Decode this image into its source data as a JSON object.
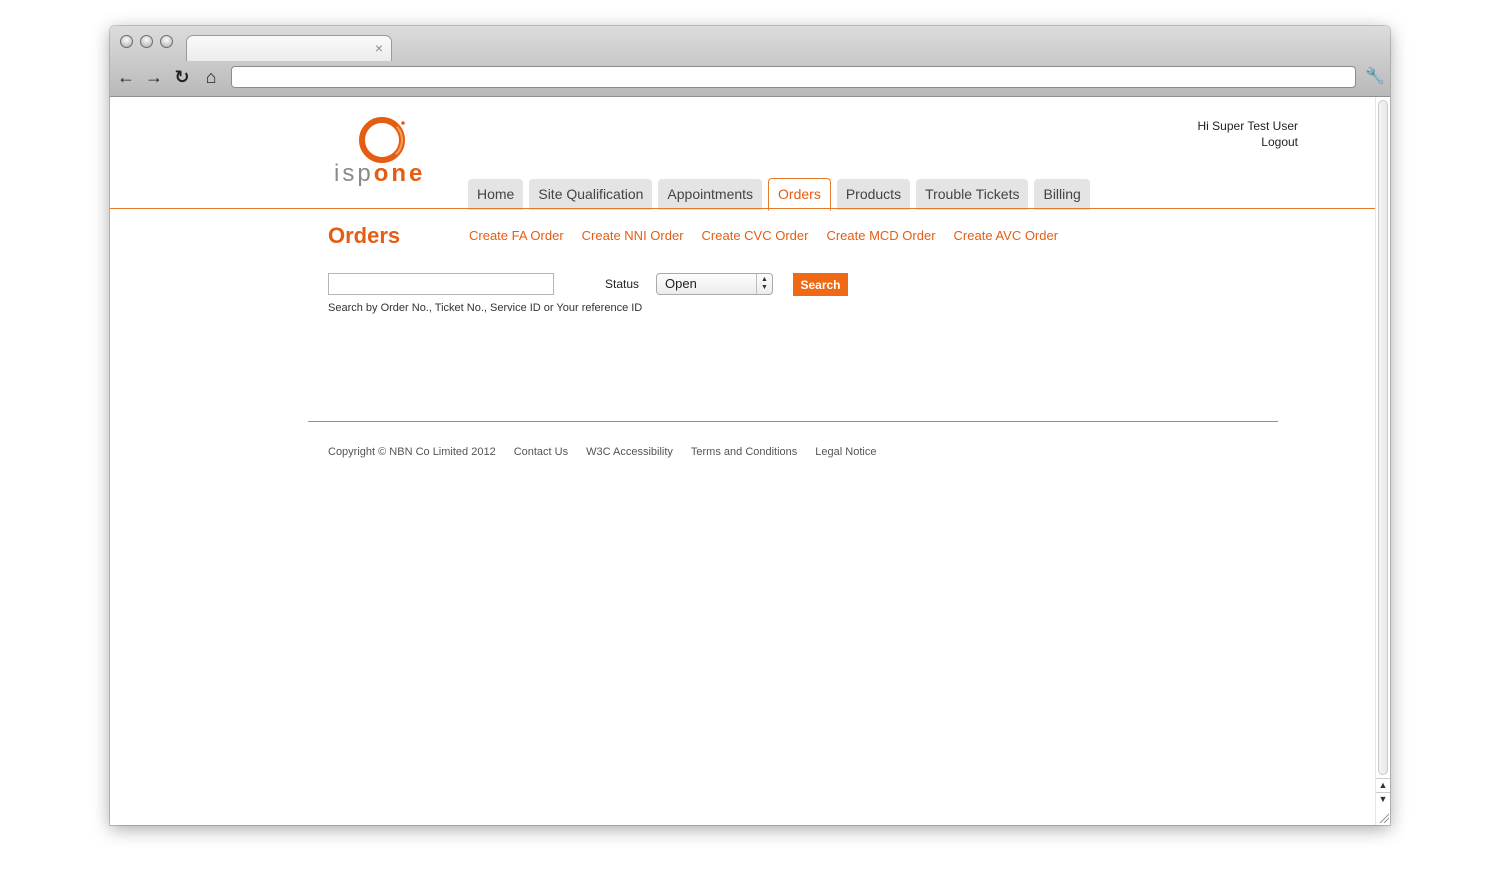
{
  "browser": {
    "tab_close_glyph": "×",
    "back_glyph": "←",
    "forward_glyph": "→",
    "reload_glyph": "↻",
    "home_glyph": "⌂",
    "bookmark_glyph": "☆",
    "wrench_glyph": "🔧",
    "url": ""
  },
  "logo": {
    "isp": "isp",
    "one": "one",
    "brand_color": "#e55d12"
  },
  "user": {
    "greeting": "Hi Super Test User",
    "logout": "Logout"
  },
  "nav": {
    "tabs": [
      {
        "label": "Home"
      },
      {
        "label": "Site Qualification"
      },
      {
        "label": "Appointments"
      },
      {
        "label": "Orders",
        "active": true
      },
      {
        "label": "Products"
      },
      {
        "label": "Trouble Tickets"
      },
      {
        "label": "Billing"
      }
    ]
  },
  "page": {
    "title": "Orders",
    "links": [
      "Create FA Order",
      "Create NNI Order",
      "Create CVC Order",
      "Create MCD Order",
      "Create AVC Order"
    ]
  },
  "search": {
    "value": "",
    "hint": "Search by Order No., Ticket No., Service ID or Your reference ID",
    "status_label": "Status",
    "status_value": "Open",
    "button": "Search"
  },
  "footer": {
    "copyright": "Copyright © NBN Co Limited 2012",
    "links": [
      "Contact Us",
      "W3C Accessibility",
      "Terms and Conditions",
      "Legal Notice"
    ]
  },
  "colors": {
    "accent": "#e55d12",
    "button": "#f06a15",
    "tab_bg": "#e4e4e4"
  },
  "scrollbar": {
    "up_glyph": "▲",
    "down_glyph": "▼"
  }
}
